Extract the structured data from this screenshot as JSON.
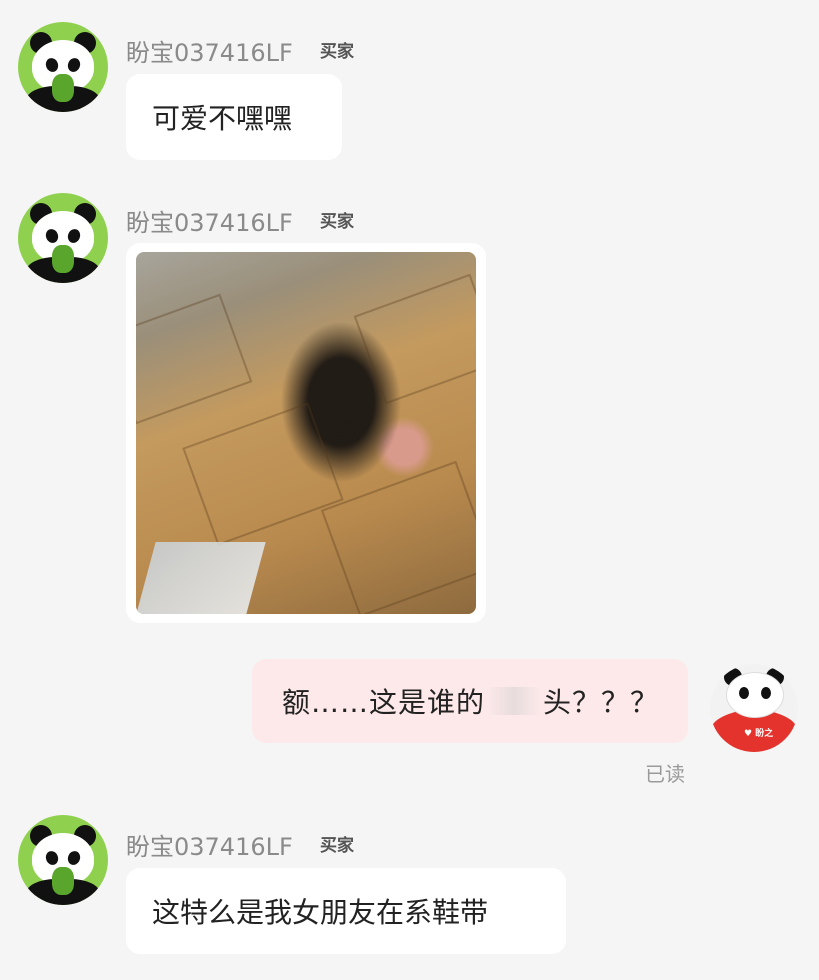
{
  "conversation": {
    "messages": [
      {
        "sender": "盼宝037416LF",
        "role_badge": "买家",
        "text": "可爱不嘿嘿"
      },
      {
        "sender": "盼宝037416LF",
        "role_badge": "买家",
        "image": "photo-message"
      },
      {
        "sender": "self",
        "text_before": "额……这是谁的",
        "text_after": "头？？？",
        "status": "已读"
      },
      {
        "sender": "盼宝037416LF",
        "role_badge": "买家",
        "text": "这特么是我女朋友在系鞋带"
      }
    ],
    "self_avatar_logo": "♥ 盼之"
  },
  "colors": {
    "background": "#f5f5f5",
    "incoming_bubble": "#ffffff",
    "outgoing_bubble": "#fde9ea",
    "avatar_green": "#8fd14f",
    "avatar_red": "#e3332c"
  },
  "icons": [
    "panda-avatar-icon",
    "panda-red-avatar-icon"
  ]
}
